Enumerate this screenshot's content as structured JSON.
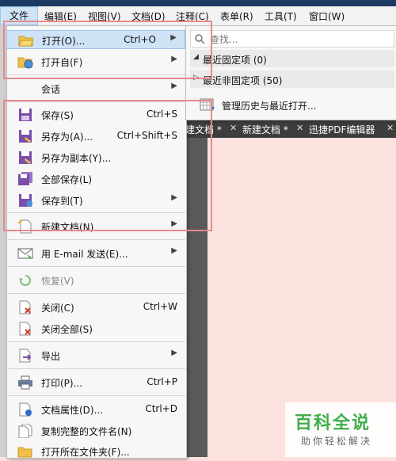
{
  "menubar": {
    "items": [
      "文件",
      "编辑(E)",
      "视图(V)",
      "文档(D)",
      "注释(C)",
      "表单(R)",
      "工具(T)",
      "窗口(W)"
    ]
  },
  "file_menu": {
    "open": {
      "label": "打开(O)...",
      "shortcut": "Ctrl+O"
    },
    "open_from": {
      "label": "打开自(F)"
    },
    "session": {
      "label": "会话"
    },
    "save": {
      "label": "保存(S)",
      "shortcut": "Ctrl+S"
    },
    "save_as": {
      "label": "另存为(A)...",
      "shortcut": "Ctrl+Shift+S"
    },
    "save_copy": {
      "label": "另存为副本(Y)..."
    },
    "save_all": {
      "label": "全部保存(L)"
    },
    "save_to": {
      "label": "保存到(T)"
    },
    "new_doc": {
      "label": "新建文档(N)"
    },
    "email": {
      "label": "用 E-mail 发送(E)..."
    },
    "restore": {
      "label": "恢复(V)"
    },
    "close": {
      "label": "关闭(C)",
      "shortcut": "Ctrl+W"
    },
    "close_all": {
      "label": "关闭全部(S)"
    },
    "export": {
      "label": "导出"
    },
    "print": {
      "label": "打印(P)...",
      "shortcut": "Ctrl+P"
    },
    "props": {
      "label": "文档属性(D)...",
      "shortcut": "Ctrl+D"
    },
    "copy_name": {
      "label": "复制完整的文件名(N)"
    },
    "open_folder": {
      "label": "打开所在文件夹(F)..."
    }
  },
  "submenu": {
    "search_placeholder": "查找...",
    "pinned": "最近固定项 (0)",
    "unpinned": "最近非固定项 (50)",
    "history": "管理历史与最近打开..."
  },
  "tabs": [
    {
      "label": "建文档 *"
    },
    {
      "label": "新建文档 *"
    },
    {
      "label": "迅捷PDF编辑器"
    }
  ],
  "watermark": {
    "main": "百科全说",
    "sub": "助你轻松解决"
  }
}
